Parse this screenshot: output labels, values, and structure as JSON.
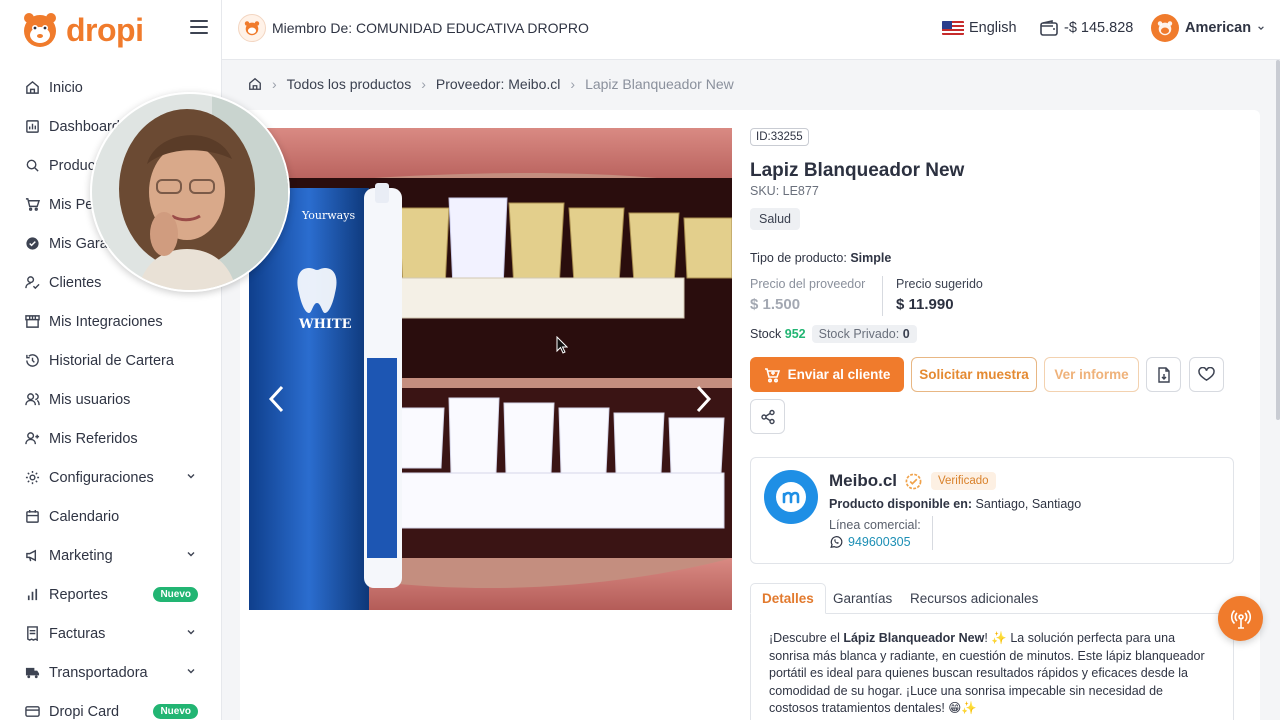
{
  "brand": {
    "name": "dropi",
    "color": "#f07b2c"
  },
  "sidebar": {
    "items": [
      {
        "label": "Inicio",
        "icon": "home-icon"
      },
      {
        "label": "Dashboard",
        "icon": "dashboard-icon"
      },
      {
        "label": "Productos",
        "icon": "search-icon"
      },
      {
        "label": "Mis Pedidos",
        "icon": "cart-icon"
      },
      {
        "label": "Mis Garantías",
        "icon": "shield-check-icon"
      },
      {
        "label": "Clientes",
        "icon": "user-check-icon"
      },
      {
        "label": "Mis Integraciones",
        "icon": "store-icon"
      },
      {
        "label": "Historial de Cartera",
        "icon": "history-icon"
      },
      {
        "label": "Mis usuarios",
        "icon": "users-icon"
      },
      {
        "label": "Mis Referidos",
        "icon": "user-plus-icon"
      },
      {
        "label": "Configuraciones",
        "icon": "gear-icon"
      },
      {
        "label": "Calendario",
        "icon": "calendar-icon"
      },
      {
        "label": "Marketing",
        "icon": "megaphone-icon"
      },
      {
        "label": "Reportes",
        "icon": "bar-chart-icon"
      },
      {
        "label": "Facturas",
        "icon": "invoice-icon"
      },
      {
        "label": "Transportadora",
        "icon": "truck-icon"
      },
      {
        "label": "Dropi Card",
        "icon": "card-icon"
      }
    ],
    "new_badge": "Nuevo"
  },
  "header": {
    "member_label": "Miembro De: COMUNIDAD EDUCATIVA DROPRO",
    "language": "English",
    "balance": "-$ 145.828",
    "user_name": "American"
  },
  "breadcrumb": {
    "all_products": "Todos los productos",
    "supplier": "Proveedor: Meibo.cl",
    "current": "Lapiz Blanqueador New"
  },
  "product": {
    "id_label": "ID:33255",
    "title": "Lapiz Blanqueador New",
    "sku": "SKU: LE877",
    "category": "Salud",
    "type_label": "Tipo de producto:",
    "type_value": "Simple",
    "supplier_price_label": "Precio del proveedor",
    "supplier_price": "$ 1.500",
    "suggested_price_label": "Precio sugerido",
    "suggested_price": "$ 11.990",
    "stock_label": "Stock",
    "stock_value": "952",
    "private_stock_label": "Stock Privado:",
    "private_stock_value": "0",
    "package_text": "WHITE",
    "package_brand": "Yourways"
  },
  "actions": {
    "send_client": "Enviar al cliente",
    "request_sample": "Solicitar muestra",
    "view_report": "Ver informe"
  },
  "supplier": {
    "name": "Meibo.cl",
    "verified": "Verificado",
    "available_label": "Producto disponible en:",
    "available_value": "Santiago, Santiago",
    "line_label": "Línea comercial:",
    "phone": "949600305"
  },
  "tabs": {
    "details": "Detalles",
    "warranties": "Garantías",
    "resources": "Recursos adicionales"
  },
  "description": {
    "intro": "¡Descubre el ",
    "product_name": "Lápiz Blanqueador New",
    "body": "! ✨ La solución perfecta para una sonrisa más blanca y radiante, en cuestión de minutos. Este lápiz blanqueador portátil es ideal para quienes buscan resultados rápidos y eficaces desde la comodidad de su hogar. ¡Luce una sonrisa impecable sin necesidad de costosos tratamientos dentales! 😁✨"
  },
  "colors": {
    "accent": "#f07b2c",
    "success": "#22b573",
    "link": "#1c8fb5",
    "supplier_logo": "#1f8fe5"
  }
}
